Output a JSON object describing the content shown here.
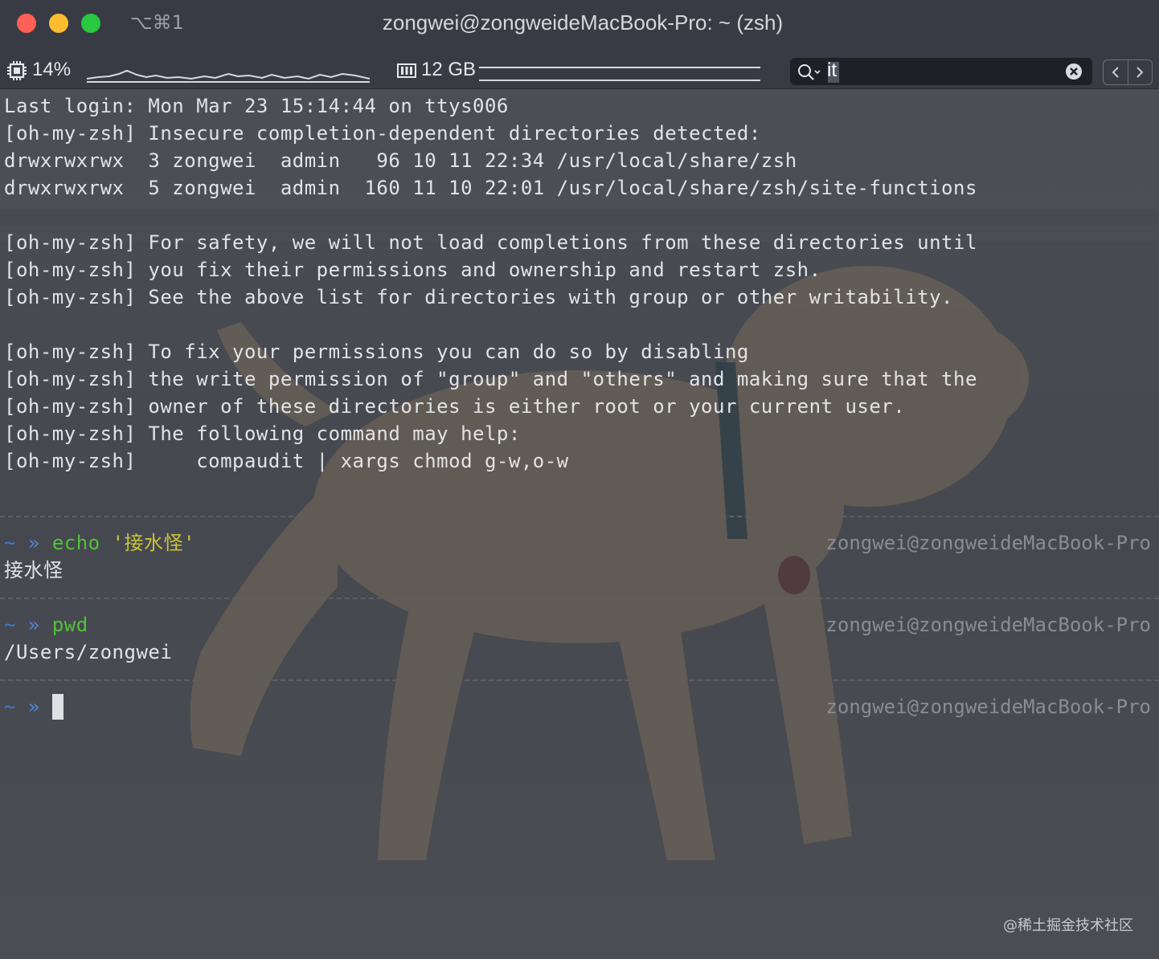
{
  "window": {
    "title": "zongwei@zongweideMacBook-Pro: ~ (zsh)",
    "shortcut": "⌥⌘1"
  },
  "statusbar": {
    "cpu": "14%",
    "cpu_icon": "cpu-chip-icon",
    "memory": "12 GB",
    "memory_icon": "memory-module-icon",
    "search_value": "it",
    "search_icon": "search-icon",
    "clear_icon": "clear-search-icon",
    "nav_icons": [
      "chevron-left-icon",
      "chevron-right-icon"
    ]
  },
  "terminal": {
    "lines": [
      "Last login: Mon Mar 23 15:14:44 on ttys006",
      "[oh-my-zsh] Insecure completion-dependent directories detected:",
      "drwxrwxrwx  3 zongwei  admin   96 10 11 22:34 /usr/local/share/zsh",
      "drwxrwxrwx  5 zongwei  admin  160 11 10 22:01 /usr/local/share/zsh/site-functions",
      "",
      "[oh-my-zsh] For safety, we will not load completions from these directories until",
      "[oh-my-zsh] you fix their permissions and ownership and restart zsh.",
      "[oh-my-zsh] See the above list for directories with group or other writability.",
      "",
      "[oh-my-zsh] To fix your permissions you can do so by disabling",
      "[oh-my-zsh] the write permission of \"group\" and \"others\" and making sure that the",
      "[oh-my-zsh] owner of these directories is either root or your current user.",
      "[oh-my-zsh] The following command may help:",
      "[oh-my-zsh]     compaudit | xargs chmod g-w,o-w"
    ],
    "prompt_tilde": "~",
    "prompt_arrow": "»",
    "host": "zongwei@zongweideMacBook-Pro",
    "blocks": [
      {
        "command": "echo",
        "argument": "'接水怪'",
        "output": "接水怪"
      },
      {
        "command": "pwd",
        "argument": "",
        "output": "/Users/zongwei"
      }
    ]
  },
  "watermark": "@稀土掘金技术社区",
  "colors": {
    "prompt": "#3b7bd0",
    "command": "#4fc33a",
    "string": "#c9c33a",
    "host": "#8a8c90"
  }
}
